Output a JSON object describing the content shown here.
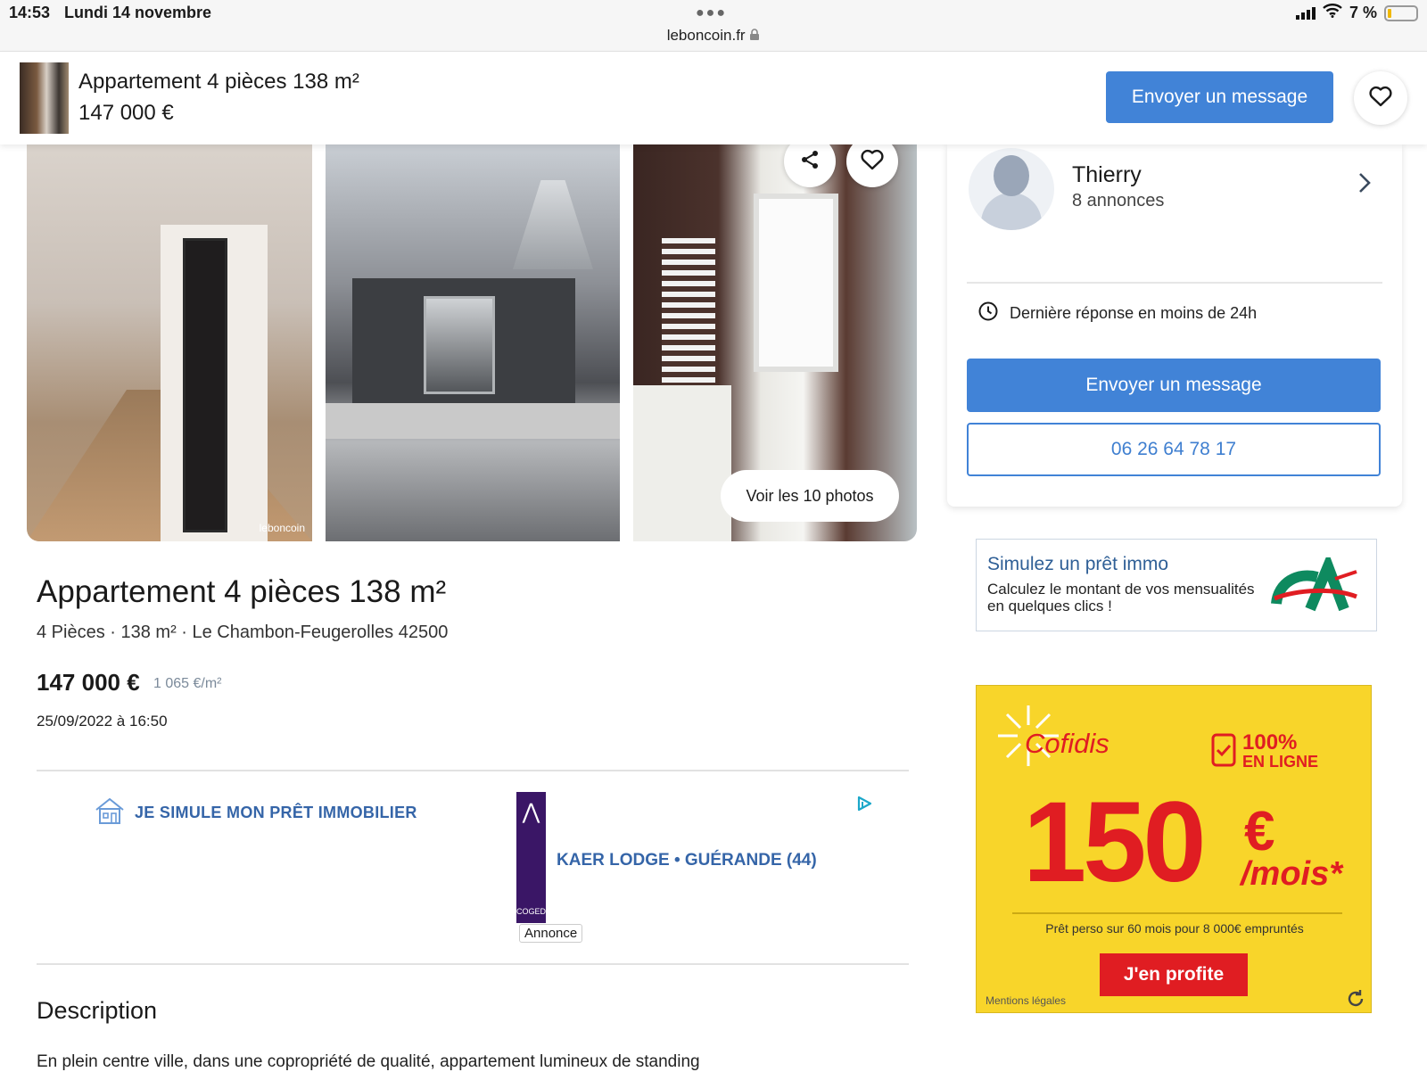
{
  "status_bar": {
    "time": "14:53",
    "date": "Lundi 14 novembre",
    "url": "leboncoin.fr",
    "battery": "7 %"
  },
  "sticky_header": {
    "title": "Appartement 4 pièces 138 m²",
    "price": "147 000 €",
    "message_button": "Envoyer un message"
  },
  "gallery": {
    "photos_button": "Voir les 10 photos",
    "watermark": "leboncoin"
  },
  "listing": {
    "title": "Appartement 4 pièces 138 m²",
    "subinfo": "4 Pièces · 138 m² · Le Chambon-Feugerolles 42500",
    "price": "147 000 €",
    "price_per_m2": "1 065 €/m²",
    "date": "25/09/2022 à 16:50"
  },
  "ad_block": {
    "simulate_link": "JE SIMULE MON PRÊT IMMOBILIER",
    "logo_text": "COGEDIM",
    "kaer_link": "KAER LODGE • GUÉRANDE (44)",
    "annonce_label": "Annonce"
  },
  "description": {
    "title": "Description",
    "text": "En plein centre ville, dans une copropriété de qualité, appartement lumineux de standing"
  },
  "seller": {
    "name": "Thierry",
    "count": "8 annonces",
    "response": "Dernière réponse en moins de 24h",
    "message_button": "Envoyer un message",
    "phone": "06 26 64 78 17"
  },
  "ca_ad": {
    "title": "Simulez un prêt immo",
    "text": "Calculez le montant de vos mensualités en quelques clics !"
  },
  "cofidis_ad": {
    "brand": "Cofidis",
    "online_pct": "100%",
    "online_word": "EN LIGNE",
    "amount": "150",
    "currency": "€",
    "period": "/mois*",
    "small": "Prêt perso sur 60 mois pour 8 000€ empruntés",
    "button": "J'en profite",
    "legal": "Mentions légales"
  },
  "colors": {
    "accent_blue": "#4183d7",
    "cofidis_yellow": "#f8d52a",
    "cofidis_red": "#e01d22",
    "ca_green": "#0e8a5f"
  }
}
